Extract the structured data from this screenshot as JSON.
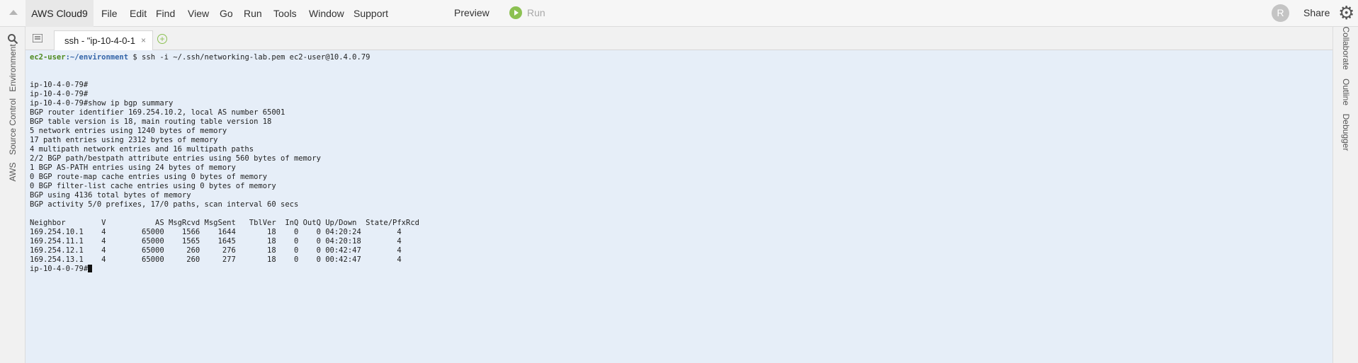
{
  "menubar": {
    "brand": "AWS Cloud9",
    "items": [
      "File",
      "Edit",
      "Find",
      "View",
      "Go",
      "Run",
      "Tools",
      "Window",
      "Support"
    ],
    "preview": "Preview",
    "run": "Run",
    "avatar_letter": "R",
    "share": "Share",
    "gear_icon": "gear-icon"
  },
  "left_panel": {
    "tabs": [
      "Environment",
      "Source Control",
      "AWS"
    ]
  },
  "right_panel": {
    "tabs": [
      "Collaborate",
      "Outline",
      "Debugger"
    ]
  },
  "tabs": [
    {
      "title": "ssh - \"ip-10-4-0-1",
      "close": "×"
    }
  ],
  "terminal": {
    "prompt_user": "ec2-user",
    "prompt_path": ":~/environment",
    "command": " $ ssh -i ~/.ssh/networking-lab.pem ec2-user@10.4.0.79",
    "lines": [
      "ip-10-4-0-79#",
      "ip-10-4-0-79#",
      "ip-10-4-0-79#show ip bgp summary",
      "BGP router identifier 169.254.10.2, local AS number 65001",
      "BGP table version is 18, main routing table version 18",
      "5 network entries using 1240 bytes of memory",
      "17 path entries using 2312 bytes of memory",
      "4 multipath network entries and 16 multipath paths",
      "2/2 BGP path/bestpath attribute entries using 560 bytes of memory",
      "1 BGP AS-PATH entries using 24 bytes of memory",
      "0 BGP route-map cache entries using 0 bytes of memory",
      "0 BGP filter-list cache entries using 0 bytes of memory",
      "BGP using 4136 total bytes of memory",
      "BGP activity 5/0 prefixes, 17/0 paths, scan interval 60 secs",
      "",
      "Neighbor        V           AS MsgRcvd MsgSent   TblVer  InQ OutQ Up/Down  State/PfxRcd",
      "169.254.10.1    4        65000    1566    1644       18    0    0 04:20:24        4",
      "169.254.11.1    4        65000    1565    1645       18    0    0 04:20:18        4",
      "169.254.12.1    4        65000     260     276       18    0    0 00:42:47        4",
      "169.254.13.1    4        65000     260     277       18    0    0 00:42:47        4"
    ],
    "final_prompt": "ip-10-4-0-79#"
  }
}
